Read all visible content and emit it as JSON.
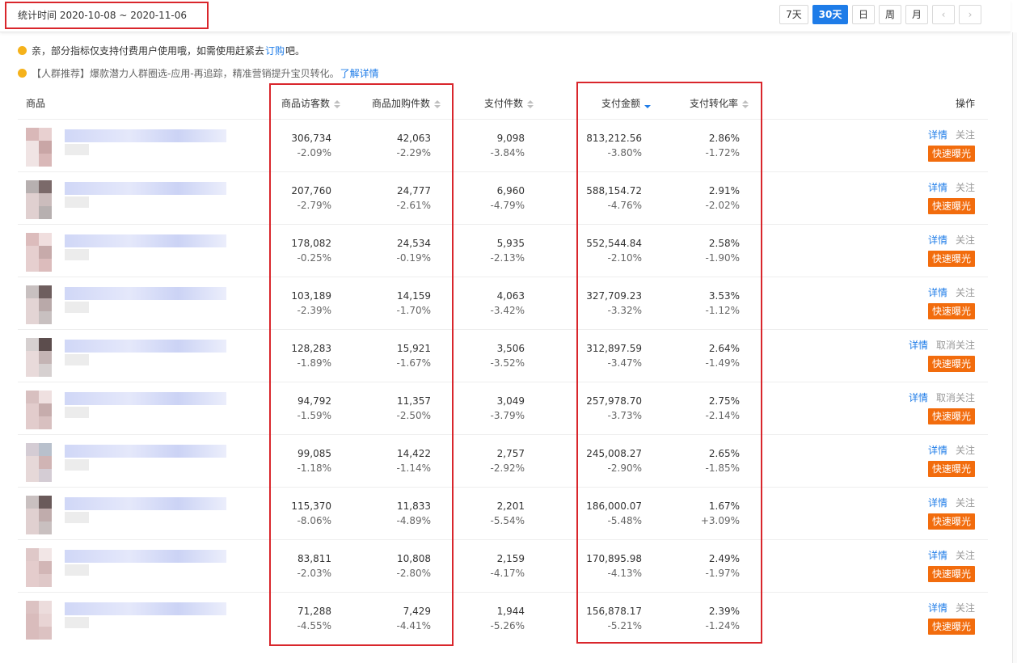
{
  "period_label": "统计时间 2020-10-08 ~ 2020-11-06",
  "period_buttons": [
    "7天",
    "30天",
    "日",
    "周",
    "月"
  ],
  "active_period": "30天",
  "notices": [
    {
      "pre": "亲，部分指标仅支持付费用户使用哦，如需使用赶紧去",
      "link": "订购",
      "post": "吧。"
    },
    {
      "pre": "【人群推荐】爆款潜力人群圈选-应用-再追踪，精准营销提升宝贝转化。",
      "link": "了解详情",
      "post": ""
    }
  ],
  "columns": {
    "product": "商品",
    "visitors": "商品访客数",
    "cart": "商品加购件数",
    "paid_items": "支付件数",
    "paid_amount": "支付金额",
    "conversion": "支付转化率",
    "actions": "操作"
  },
  "sorted_column": "支付金额",
  "row_actions": {
    "detail": "详情",
    "expose": "快速曝光"
  },
  "rows": [
    {
      "visitors": "306,734",
      "visitors_chg": "-2.09%",
      "cart": "42,063",
      "cart_chg": "-2.29%",
      "items": "9,098",
      "items_chg": "-3.84%",
      "amount": "813,212.56",
      "amount_chg": "-3.80%",
      "rate": "2.86%",
      "rate_chg": "-1.72%",
      "follow": "关注"
    },
    {
      "visitors": "207,760",
      "visitors_chg": "-2.79%",
      "cart": "24,777",
      "cart_chg": "-2.61%",
      "items": "6,960",
      "items_chg": "-4.79%",
      "amount": "588,154.72",
      "amount_chg": "-4.76%",
      "rate": "2.91%",
      "rate_chg": "-2.02%",
      "follow": "关注"
    },
    {
      "visitors": "178,082",
      "visitors_chg": "-0.25%",
      "cart": "24,534",
      "cart_chg": "-0.19%",
      "items": "5,935",
      "items_chg": "-2.13%",
      "amount": "552,544.84",
      "amount_chg": "-2.10%",
      "rate": "2.58%",
      "rate_chg": "-1.90%",
      "follow": "关注"
    },
    {
      "visitors": "103,189",
      "visitors_chg": "-2.39%",
      "cart": "14,159",
      "cart_chg": "-1.70%",
      "items": "4,063",
      "items_chg": "-3.42%",
      "amount": "327,709.23",
      "amount_chg": "-3.32%",
      "rate": "3.53%",
      "rate_chg": "-1.12%",
      "follow": "关注"
    },
    {
      "visitors": "128,283",
      "visitors_chg": "-1.89%",
      "cart": "15,921",
      "cart_chg": "-1.67%",
      "items": "3,506",
      "items_chg": "-3.52%",
      "amount": "312,897.59",
      "amount_chg": "-3.47%",
      "rate": "2.64%",
      "rate_chg": "-1.49%",
      "follow": "取消关注"
    },
    {
      "visitors": "94,792",
      "visitors_chg": "-1.59%",
      "cart": "11,357",
      "cart_chg": "-2.50%",
      "items": "3,049",
      "items_chg": "-3.79%",
      "amount": "257,978.70",
      "amount_chg": "-3.73%",
      "rate": "2.75%",
      "rate_chg": "-2.14%",
      "follow": "取消关注"
    },
    {
      "visitors": "99,085",
      "visitors_chg": "-1.18%",
      "cart": "14,422",
      "cart_chg": "-1.14%",
      "items": "2,757",
      "items_chg": "-2.92%",
      "amount": "245,008.27",
      "amount_chg": "-2.90%",
      "rate": "2.65%",
      "rate_chg": "-1.85%",
      "follow": "关注"
    },
    {
      "visitors": "115,370",
      "visitors_chg": "-8.06%",
      "cart": "11,833",
      "cart_chg": "-4.89%",
      "items": "2,201",
      "items_chg": "-5.54%",
      "amount": "186,000.07",
      "amount_chg": "-5.48%",
      "rate": "1.67%",
      "rate_chg": "+3.09%",
      "follow": "关注"
    },
    {
      "visitors": "83,811",
      "visitors_chg": "-2.03%",
      "cart": "10,808",
      "cart_chg": "-2.80%",
      "items": "2,159",
      "items_chg": "-4.17%",
      "amount": "170,895.98",
      "amount_chg": "-4.13%",
      "rate": "2.49%",
      "rate_chg": "-1.97%",
      "follow": "关注"
    },
    {
      "visitors": "71,288",
      "visitors_chg": "-4.55%",
      "cart": "7,429",
      "cart_chg": "-4.41%",
      "items": "1,944",
      "items_chg": "-5.26%",
      "amount": "156,878.17",
      "amount_chg": "-5.21%",
      "rate": "2.39%",
      "rate_chg": "-1.24%",
      "follow": "关注"
    }
  ],
  "colors": {
    "accent": "#1e7ce8",
    "highlight_box": "#d9262c",
    "expose_button": "#f26c0d",
    "notice_dot": "#f5b21b"
  }
}
